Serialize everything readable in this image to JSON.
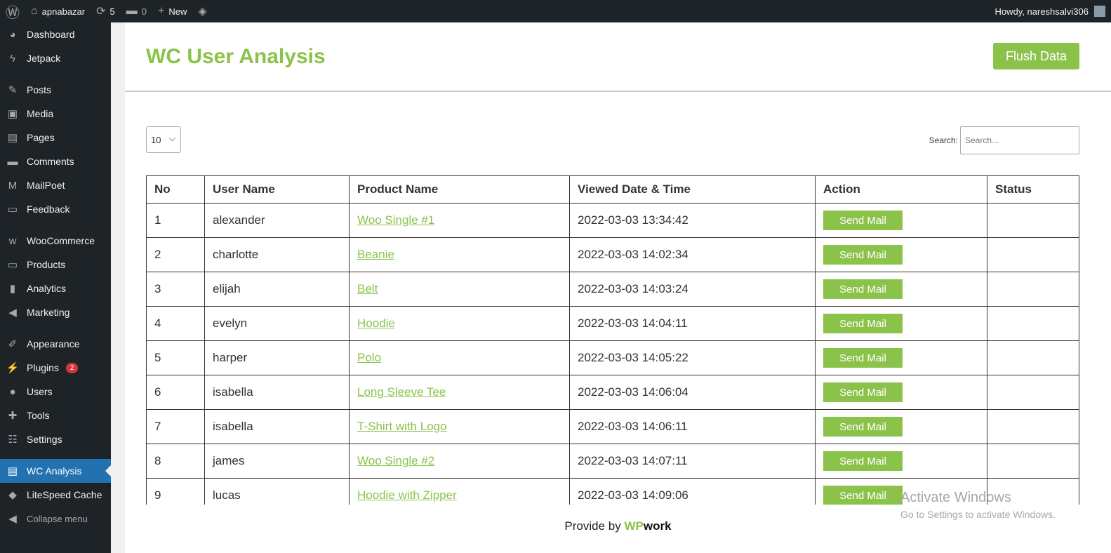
{
  "adminbar": {
    "site": "apnabazar",
    "updates": "5",
    "comments": "0",
    "new": "New",
    "howdy": "Howdy, nareshsalvi306"
  },
  "sidebar": [
    {
      "label": "Dashboard",
      "icon": "dashboard-icon",
      "g": "◕"
    },
    {
      "label": "Jetpack",
      "icon": "jetpack-icon",
      "g": "ϟ"
    },
    {
      "gap": true
    },
    {
      "label": "Posts",
      "icon": "pin-icon",
      "g": "✎"
    },
    {
      "label": "Media",
      "icon": "media-icon",
      "g": "▣"
    },
    {
      "label": "Pages",
      "icon": "pages-icon",
      "g": "▤"
    },
    {
      "label": "Comments",
      "icon": "comment-icon",
      "g": "▬"
    },
    {
      "label": "MailPoet",
      "icon": "mailpoet-icon",
      "g": "M"
    },
    {
      "label": "Feedback",
      "icon": "feedback-icon",
      "g": "▭"
    },
    {
      "gap": true
    },
    {
      "label": "WooCommerce",
      "icon": "woocommerce-icon",
      "g": "w"
    },
    {
      "label": "Products",
      "icon": "products-icon",
      "g": "▭"
    },
    {
      "label": "Analytics",
      "icon": "analytics-icon",
      "g": "▮"
    },
    {
      "label": "Marketing",
      "icon": "megaphone-icon",
      "g": "◀"
    },
    {
      "gap": true
    },
    {
      "label": "Appearance",
      "icon": "brush-icon",
      "g": "✐"
    },
    {
      "label": "Plugins",
      "icon": "plugin-icon",
      "g": "⚡",
      "badge": "2"
    },
    {
      "label": "Users",
      "icon": "user-icon",
      "g": "●"
    },
    {
      "label": "Tools",
      "icon": "wrench-icon",
      "g": "✚"
    },
    {
      "label": "Settings",
      "icon": "settings-icon",
      "g": "☷"
    },
    {
      "gap": true
    },
    {
      "label": "WC Analysis",
      "icon": "id-card-icon",
      "g": "▤",
      "active": true
    },
    {
      "label": "LiteSpeed Cache",
      "icon": "litespeed-icon",
      "g": "◆"
    },
    {
      "label": "Collapse menu",
      "icon": "collapse-icon",
      "g": "◀",
      "collapse": true
    }
  ],
  "page": {
    "title": "WC User Analysis",
    "flush": "Flush Data",
    "length": "10",
    "search_label": "Search:",
    "search_placeholder": "Search..."
  },
  "table": {
    "headers": [
      "No",
      "User Name",
      "Product Name",
      "Viewed Date & Time",
      "Action",
      "Status"
    ],
    "action_label": "Send Mail",
    "rows": [
      [
        "1",
        "alexander",
        "Woo Single #1",
        "2022-03-03 13:34:42",
        ""
      ],
      [
        "2",
        "charlotte",
        "Beanie",
        "2022-03-03 14:02:34",
        ""
      ],
      [
        "3",
        "elijah",
        "Belt",
        "2022-03-03 14:03:24",
        ""
      ],
      [
        "4",
        "evelyn",
        "Hoodie",
        "2022-03-03 14:04:11",
        ""
      ],
      [
        "5",
        "harper",
        "Polo",
        "2022-03-03 14:05:22",
        ""
      ],
      [
        "6",
        "isabella",
        "Long Sleeve Tee",
        "2022-03-03 14:06:04",
        ""
      ],
      [
        "7",
        "isabella",
        "T-Shirt with Logo",
        "2022-03-03 14:06:11",
        ""
      ],
      [
        "8",
        "james",
        "Woo Single #2",
        "2022-03-03 14:07:11",
        ""
      ],
      [
        "9",
        "lucas",
        "Hoodie with Zipper",
        "2022-03-03 14:09:06",
        ""
      ]
    ]
  },
  "footer": {
    "prefix": "Provide by",
    "brand1": "WP",
    "brand2": "work"
  },
  "watermark": {
    "line1": "Activate Windows",
    "line2": "Go to Settings to activate Windows."
  },
  "colors": {
    "accent": "#8bc34a",
    "adminbar": "#1d2327",
    "active": "#2271b1"
  }
}
